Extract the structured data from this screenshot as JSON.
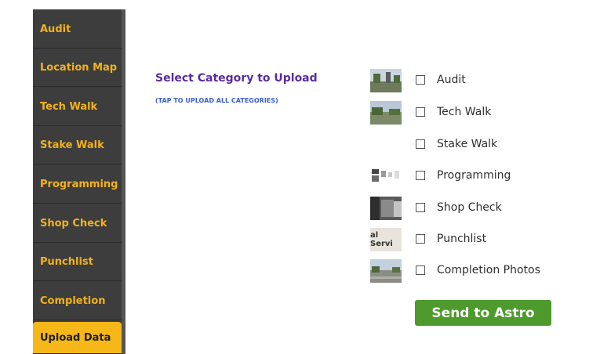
{
  "sidebar": {
    "items": [
      {
        "label": "Audit",
        "active": false
      },
      {
        "label": "Location Map",
        "active": false
      },
      {
        "label": "Tech Walk",
        "active": false
      },
      {
        "label": "Stake Walk",
        "active": false
      },
      {
        "label": "Programming",
        "active": false
      },
      {
        "label": "Shop Check",
        "active": false
      },
      {
        "label": "Punchlist",
        "active": false
      },
      {
        "label": "Completion",
        "active": false
      },
      {
        "label": "Upload Data",
        "active": true
      }
    ],
    "colors": {
      "background": "#3d3d3d",
      "text": "#f2b21d",
      "active_bg": "#f6b719"
    }
  },
  "main": {
    "title": "Select Category to Upload",
    "upload_all_link": "(TAP TO UPLOAD ALL CATEGORIES)",
    "categories": [
      {
        "label": "Audit",
        "checked": false,
        "thumbnail": "street-photo"
      },
      {
        "label": "Tech Walk",
        "checked": false,
        "thumbnail": "street-photo"
      },
      {
        "label": "Stake Walk",
        "checked": false,
        "thumbnail": "none"
      },
      {
        "label": "Programming",
        "checked": false,
        "thumbnail": "device-photo"
      },
      {
        "label": "Shop Check",
        "checked": false,
        "thumbnail": "equipment-photo"
      },
      {
        "label": "Punchlist",
        "checked": false,
        "thumbnail": "sign-photo",
        "thumbnail_text": "al Servi"
      },
      {
        "label": "Completion Photos",
        "checked": false,
        "thumbnail": "street-photo"
      }
    ],
    "send_button": "Send to Astro"
  },
  "colors": {
    "title": "#5a2ca0",
    "link": "#3a5fd0",
    "button": "#4e9a2c"
  }
}
